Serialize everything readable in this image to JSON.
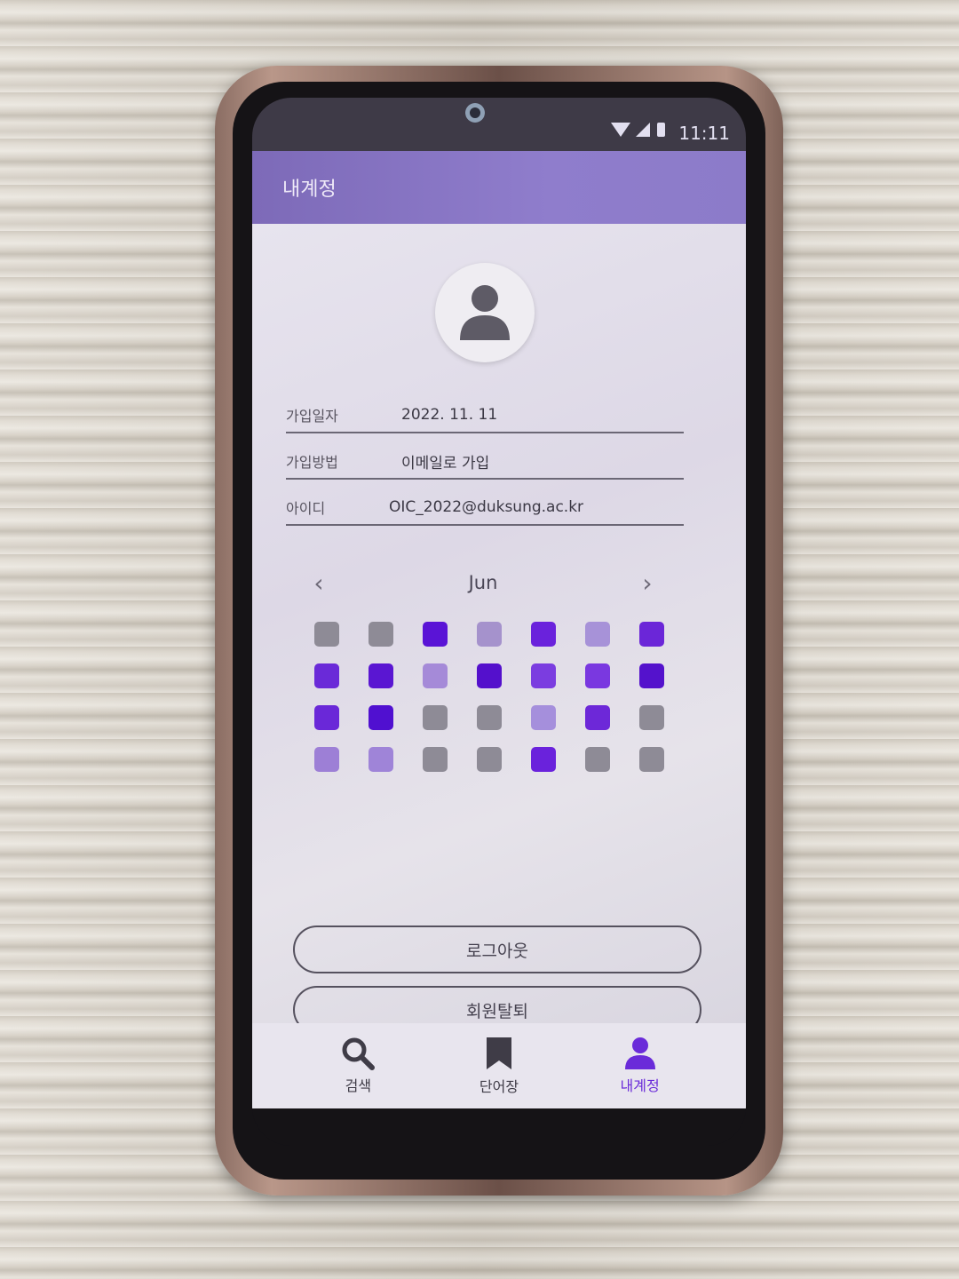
{
  "status_bar": {
    "time": "11:11",
    "icons": [
      "wifi-icon",
      "signal-icon",
      "battery-icon"
    ]
  },
  "app_bar": {
    "title": "내계정"
  },
  "profile": {
    "rows": [
      {
        "label": "가입일자",
        "value": "2022. 11. 11"
      },
      {
        "label": "가입방법",
        "value": "이메일로 가입"
      },
      {
        "label": "아이디",
        "value": "OIC_2022@duksung.ac.kr"
      }
    ]
  },
  "calendar": {
    "month": "Jun",
    "prev_icon": "chevron-left-icon",
    "next_icon": "chevron-right-icon",
    "cells": [
      "#8e8b96",
      "#8e8b96",
      "#5a14d6",
      "#a592cc",
      "#6a22dc",
      "#a792d8",
      "#6b26d8",
      "#6a2ad8",
      "#5a16d2",
      "#a58ad8",
      "#5410cc",
      "#7b3de0",
      "#7a38e0",
      "#5412cc",
      "#6a28d8",
      "#5010d0",
      "#8e8b96",
      "#8e8b96",
      "#a58fdc",
      "#6d28d8",
      "#8e8b96",
      "#9d7fd6",
      "#9f84d8",
      "#8e8b96",
      "#8e8b96",
      "#6a22dc",
      "#8e8b96",
      "#8e8b96"
    ]
  },
  "buttons": {
    "logout": "로그아웃",
    "withdraw": "회원탈퇴"
  },
  "bottom_nav": {
    "items": [
      {
        "label": "검색",
        "icon": "search-icon"
      },
      {
        "label": "단어장",
        "icon": "bookmark-icon"
      },
      {
        "label": "내계정",
        "icon": "person-icon",
        "active": true
      }
    ]
  },
  "colors": {
    "accent": "#6a2bd9",
    "app_bar": "#8f7dcc"
  }
}
